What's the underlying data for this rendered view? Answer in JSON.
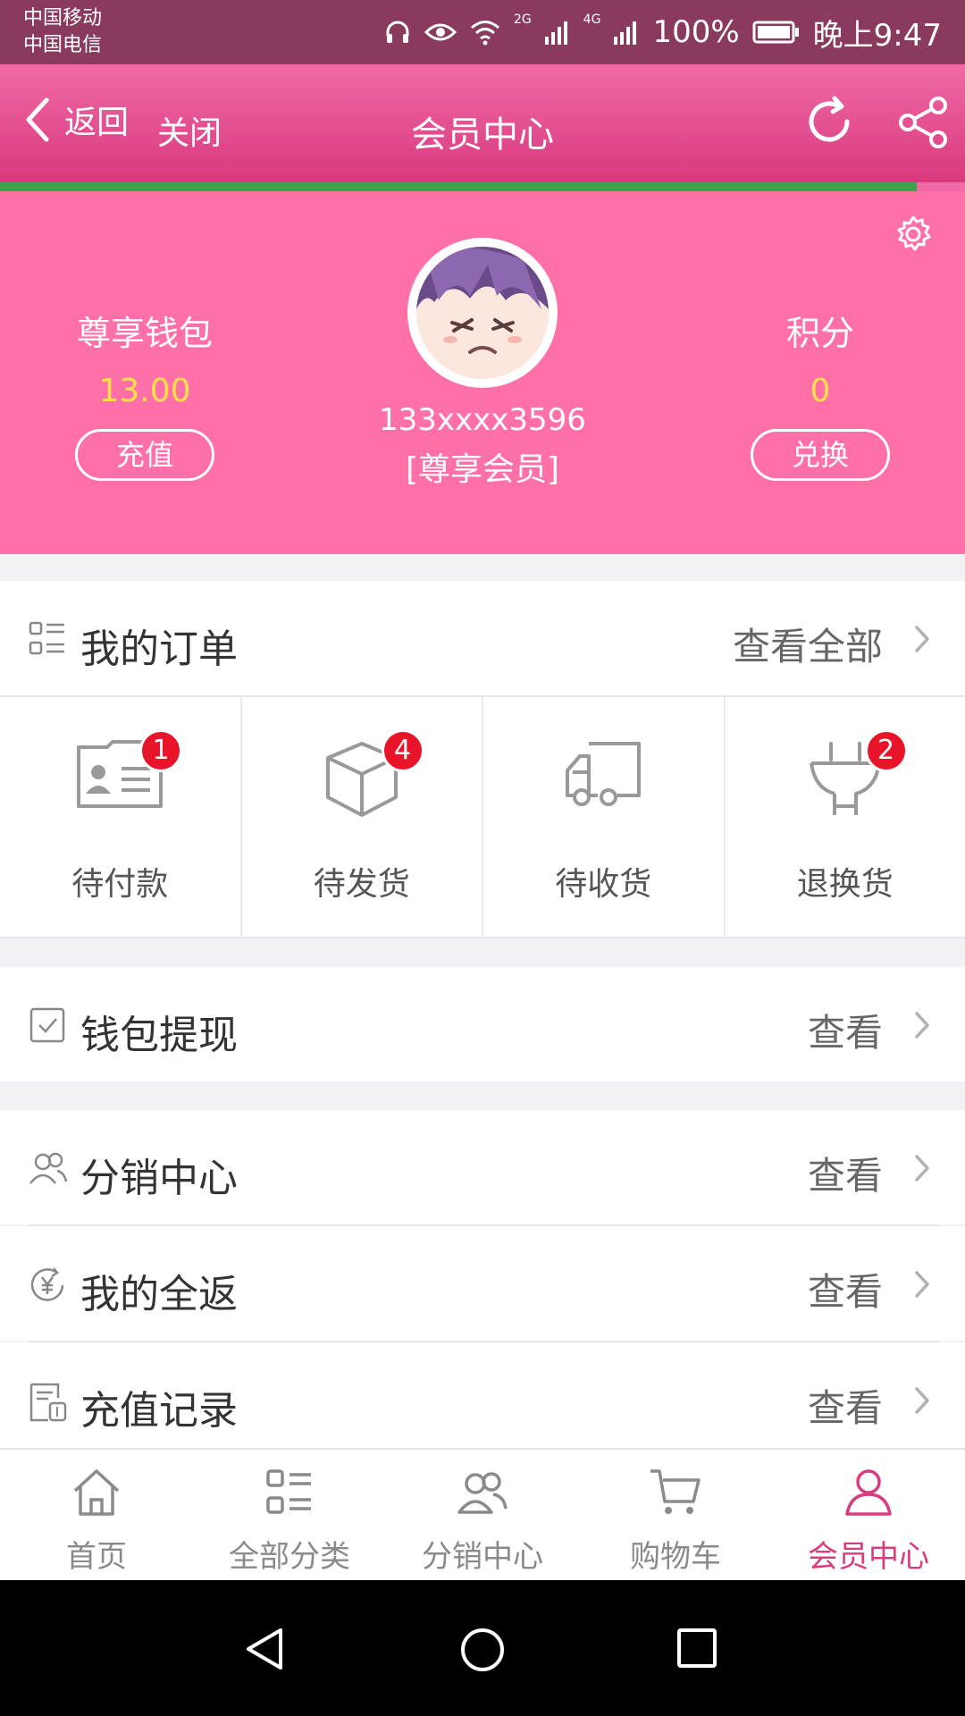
{
  "status_bar": {
    "carrier_1": "中国移动",
    "carrier_2": "中国电信",
    "network_1": "2G",
    "network_2": "4G",
    "battery": "100%",
    "time": "晚上9:47"
  },
  "header": {
    "back_label": "返回",
    "close_label": "关闭",
    "title": "会员中心",
    "icons": [
      "chevron-left-icon",
      "refresh-icon",
      "share-icon"
    ],
    "load_progress_percent": 95
  },
  "profile": {
    "wallet_label": "尊享钱包",
    "wallet_value": "13.00",
    "recharge_label": "充值",
    "points_label": "积分",
    "points_value": "0",
    "exchange_label": "兑换",
    "phone": "133xxxx3596",
    "member_level": "[尊享会员]"
  },
  "orders": {
    "title": "我的订单",
    "view_all": "查看全部",
    "items": [
      {
        "label": "待付款",
        "badge": "1",
        "icon": "id-card-icon"
      },
      {
        "label": "待发货",
        "badge": "4",
        "icon": "box-icon"
      },
      {
        "label": "待收货",
        "badge": "",
        "icon": "truck-icon"
      },
      {
        "label": "退换货",
        "badge": "2",
        "icon": "plug-icon"
      }
    ]
  },
  "menu": {
    "withdraw": {
      "label": "钱包提现",
      "action": "查看"
    },
    "distribution": {
      "label": "分销中心",
      "action": "查看"
    },
    "cashback": {
      "label": "我的全返",
      "action": "查看"
    },
    "recharge_records": {
      "label": "充值记录",
      "action": "查看"
    }
  },
  "tabbar": {
    "items": [
      {
        "label": "首页",
        "icon": "home-icon"
      },
      {
        "label": "全部分类",
        "icon": "category-icon"
      },
      {
        "label": "分销中心",
        "icon": "users-icon"
      },
      {
        "label": "购物车",
        "icon": "cart-icon"
      },
      {
        "label": "会员中心",
        "icon": "user-icon"
      }
    ],
    "active_index": 4
  },
  "colors": {
    "brand_pink": "#ff6fa8",
    "accent": "#d83d80",
    "badge_red": "#e8142a",
    "value_yellow": "#ffe14a"
  }
}
